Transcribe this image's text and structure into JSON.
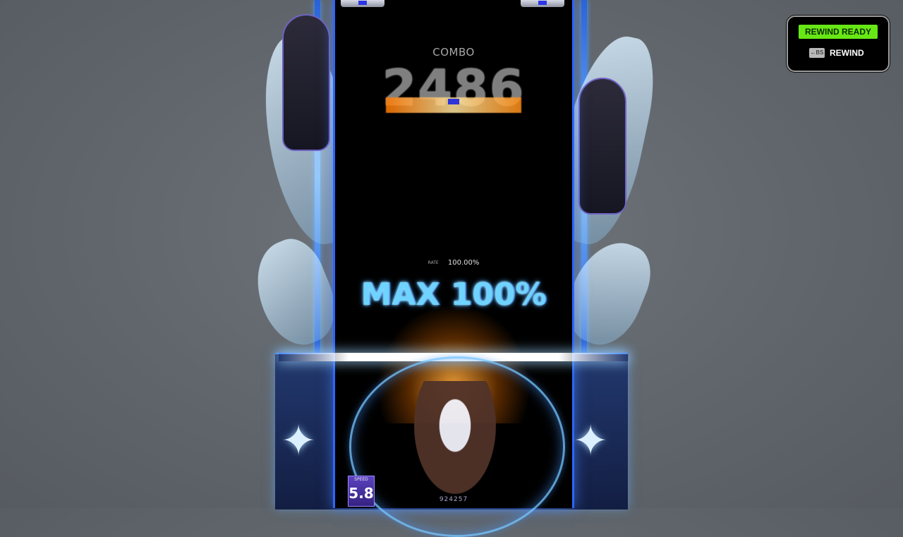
{
  "hud": {
    "combo_label": "COMBO",
    "combo_value": "2486",
    "rate_label": "RATE",
    "rate_value": "100.00%",
    "banner": "MAX 100%",
    "speed_label": "SPEED",
    "speed_value": "5.8",
    "score_value": "924257"
  },
  "rewind": {
    "ready_label": "REWIND READY",
    "key_label": "←BS",
    "action_label": "REWIND"
  }
}
